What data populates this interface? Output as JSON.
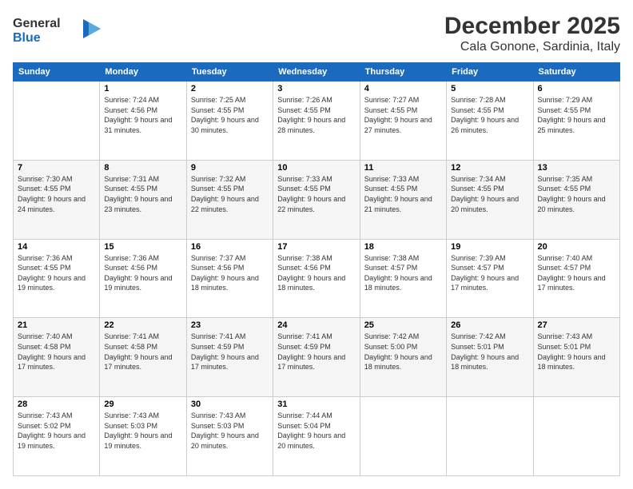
{
  "header": {
    "logo_line1": "General",
    "logo_line2": "Blue",
    "month": "December 2025",
    "location": "Cala Gonone, Sardinia, Italy"
  },
  "days_of_week": [
    "Sunday",
    "Monday",
    "Tuesday",
    "Wednesday",
    "Thursday",
    "Friday",
    "Saturday"
  ],
  "weeks": [
    [
      {
        "day": "",
        "sunrise": "",
        "sunset": "",
        "daylight": ""
      },
      {
        "day": "1",
        "sunrise": "Sunrise: 7:24 AM",
        "sunset": "Sunset: 4:56 PM",
        "daylight": "Daylight: 9 hours and 31 minutes."
      },
      {
        "day": "2",
        "sunrise": "Sunrise: 7:25 AM",
        "sunset": "Sunset: 4:55 PM",
        "daylight": "Daylight: 9 hours and 30 minutes."
      },
      {
        "day": "3",
        "sunrise": "Sunrise: 7:26 AM",
        "sunset": "Sunset: 4:55 PM",
        "daylight": "Daylight: 9 hours and 28 minutes."
      },
      {
        "day": "4",
        "sunrise": "Sunrise: 7:27 AM",
        "sunset": "Sunset: 4:55 PM",
        "daylight": "Daylight: 9 hours and 27 minutes."
      },
      {
        "day": "5",
        "sunrise": "Sunrise: 7:28 AM",
        "sunset": "Sunset: 4:55 PM",
        "daylight": "Daylight: 9 hours and 26 minutes."
      },
      {
        "day": "6",
        "sunrise": "Sunrise: 7:29 AM",
        "sunset": "Sunset: 4:55 PM",
        "daylight": "Daylight: 9 hours and 25 minutes."
      }
    ],
    [
      {
        "day": "7",
        "sunrise": "Sunrise: 7:30 AM",
        "sunset": "Sunset: 4:55 PM",
        "daylight": "Daylight: 9 hours and 24 minutes."
      },
      {
        "day": "8",
        "sunrise": "Sunrise: 7:31 AM",
        "sunset": "Sunset: 4:55 PM",
        "daylight": "Daylight: 9 hours and 23 minutes."
      },
      {
        "day": "9",
        "sunrise": "Sunrise: 7:32 AM",
        "sunset": "Sunset: 4:55 PM",
        "daylight": "Daylight: 9 hours and 22 minutes."
      },
      {
        "day": "10",
        "sunrise": "Sunrise: 7:33 AM",
        "sunset": "Sunset: 4:55 PM",
        "daylight": "Daylight: 9 hours and 22 minutes."
      },
      {
        "day": "11",
        "sunrise": "Sunrise: 7:33 AM",
        "sunset": "Sunset: 4:55 PM",
        "daylight": "Daylight: 9 hours and 21 minutes."
      },
      {
        "day": "12",
        "sunrise": "Sunrise: 7:34 AM",
        "sunset": "Sunset: 4:55 PM",
        "daylight": "Daylight: 9 hours and 20 minutes."
      },
      {
        "day": "13",
        "sunrise": "Sunrise: 7:35 AM",
        "sunset": "Sunset: 4:55 PM",
        "daylight": "Daylight: 9 hours and 20 minutes."
      }
    ],
    [
      {
        "day": "14",
        "sunrise": "Sunrise: 7:36 AM",
        "sunset": "Sunset: 4:55 PM",
        "daylight": "Daylight: 9 hours and 19 minutes."
      },
      {
        "day": "15",
        "sunrise": "Sunrise: 7:36 AM",
        "sunset": "Sunset: 4:56 PM",
        "daylight": "Daylight: 9 hours and 19 minutes."
      },
      {
        "day": "16",
        "sunrise": "Sunrise: 7:37 AM",
        "sunset": "Sunset: 4:56 PM",
        "daylight": "Daylight: 9 hours and 18 minutes."
      },
      {
        "day": "17",
        "sunrise": "Sunrise: 7:38 AM",
        "sunset": "Sunset: 4:56 PM",
        "daylight": "Daylight: 9 hours and 18 minutes."
      },
      {
        "day": "18",
        "sunrise": "Sunrise: 7:38 AM",
        "sunset": "Sunset: 4:57 PM",
        "daylight": "Daylight: 9 hours and 18 minutes."
      },
      {
        "day": "19",
        "sunrise": "Sunrise: 7:39 AM",
        "sunset": "Sunset: 4:57 PM",
        "daylight": "Daylight: 9 hours and 17 minutes."
      },
      {
        "day": "20",
        "sunrise": "Sunrise: 7:40 AM",
        "sunset": "Sunset: 4:57 PM",
        "daylight": "Daylight: 9 hours and 17 minutes."
      }
    ],
    [
      {
        "day": "21",
        "sunrise": "Sunrise: 7:40 AM",
        "sunset": "Sunset: 4:58 PM",
        "daylight": "Daylight: 9 hours and 17 minutes."
      },
      {
        "day": "22",
        "sunrise": "Sunrise: 7:41 AM",
        "sunset": "Sunset: 4:58 PM",
        "daylight": "Daylight: 9 hours and 17 minutes."
      },
      {
        "day": "23",
        "sunrise": "Sunrise: 7:41 AM",
        "sunset": "Sunset: 4:59 PM",
        "daylight": "Daylight: 9 hours and 17 minutes."
      },
      {
        "day": "24",
        "sunrise": "Sunrise: 7:41 AM",
        "sunset": "Sunset: 4:59 PM",
        "daylight": "Daylight: 9 hours and 17 minutes."
      },
      {
        "day": "25",
        "sunrise": "Sunrise: 7:42 AM",
        "sunset": "Sunset: 5:00 PM",
        "daylight": "Daylight: 9 hours and 18 minutes."
      },
      {
        "day": "26",
        "sunrise": "Sunrise: 7:42 AM",
        "sunset": "Sunset: 5:01 PM",
        "daylight": "Daylight: 9 hours and 18 minutes."
      },
      {
        "day": "27",
        "sunrise": "Sunrise: 7:43 AM",
        "sunset": "Sunset: 5:01 PM",
        "daylight": "Daylight: 9 hours and 18 minutes."
      }
    ],
    [
      {
        "day": "28",
        "sunrise": "Sunrise: 7:43 AM",
        "sunset": "Sunset: 5:02 PM",
        "daylight": "Daylight: 9 hours and 19 minutes."
      },
      {
        "day": "29",
        "sunrise": "Sunrise: 7:43 AM",
        "sunset": "Sunset: 5:03 PM",
        "daylight": "Daylight: 9 hours and 19 minutes."
      },
      {
        "day": "30",
        "sunrise": "Sunrise: 7:43 AM",
        "sunset": "Sunset: 5:03 PM",
        "daylight": "Daylight: 9 hours and 20 minutes."
      },
      {
        "day": "31",
        "sunrise": "Sunrise: 7:44 AM",
        "sunset": "Sunset: 5:04 PM",
        "daylight": "Daylight: 9 hours and 20 minutes."
      },
      {
        "day": "",
        "sunrise": "",
        "sunset": "",
        "daylight": ""
      },
      {
        "day": "",
        "sunrise": "",
        "sunset": "",
        "daylight": ""
      },
      {
        "day": "",
        "sunrise": "",
        "sunset": "",
        "daylight": ""
      }
    ]
  ]
}
